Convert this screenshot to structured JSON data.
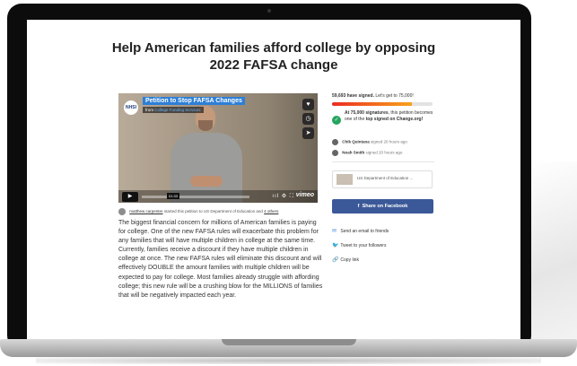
{
  "petition": {
    "title_line1": "Help American families afford college by opposing",
    "title_line2": "2022 FAFSA change"
  },
  "video": {
    "logo": "NHSI",
    "title": "Petition to Stop FAFSA Changes",
    "from_prefix": "from",
    "from_name": "College Funding Services",
    "timecode": "01:33",
    "heart": "♥",
    "clock": "◷",
    "share": "➤",
    "play": "▶",
    "controls": "ııl ⚙ ⛶",
    "brand": "vimeo"
  },
  "starter": {
    "name": "matthew carpenter",
    "middle": "started this petition to US Department of Education and",
    "others": "4 others"
  },
  "description": "The biggest financial concern for millions of American families is paying for college.  One of the new FAFSA rules will exacerbate this problem for any families that will have multiple children in college at the same time.  Currently, families receive a discount if they have multiple children in college at once.  The new FAFSA rules will eliminate this discount and will effectively DOUBLE the amount families with multiple children will be expected to pay for college.  Most families already struggle with affording college; this new rule will be a crushing blow for the MILLIONS of families that will be negatively impacted each year.",
  "signatures": {
    "count_text": "59,693 have signed.",
    "goal_text": "Let's get to 75,000!",
    "progress_fraction": 0.796,
    "milestone_bold": "At 75,000 signatures",
    "milestone_mid": ", this petition becomes one of the",
    "milestone_bold2": "top signed on Change.org!",
    "check_icon": "✓",
    "signers": [
      {
        "name": "Chik Quintana",
        "when": "signed 20 hours ago"
      },
      {
        "name": "Noah Smith",
        "when": "signed 20 hours ago"
      }
    ]
  },
  "target": {
    "label": "US Department of Education ..."
  },
  "share": {
    "facebook": "Share on Facebook",
    "facebook_icon": "f",
    "email": "Send an email to friends",
    "email_icon": "✉",
    "twitter": "Tweet to your followers",
    "twitter_icon": "🐦",
    "copy": "Copy link",
    "copy_icon": "🔗"
  },
  "colors": {
    "facebook": "#3b5998",
    "progress_start": "#ec2c22",
    "progress_end": "#f7a21b",
    "check": "#25a55f",
    "video_title_bg": "#2e7fd6"
  }
}
